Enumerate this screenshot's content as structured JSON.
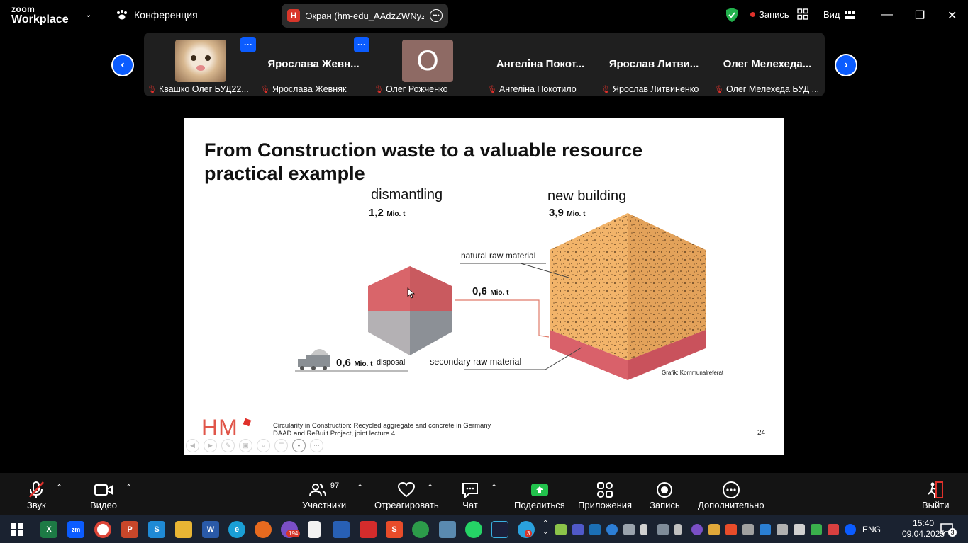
{
  "app": {
    "logo_line1": "zoom",
    "logo_line2": "Workplace",
    "conference_label": "Конференция",
    "screen_badge": "H",
    "screen_title": "Экран (hm-edu_AAdzZWNyZXQ",
    "record_label": "Запись",
    "view_label": "Вид",
    "accent_color": "#0b5cff"
  },
  "participants": [
    {
      "name": "Квашко Олег БУД22...",
      "big_name": "",
      "avatar": "cat-photo",
      "muted": true
    },
    {
      "name": "Ярослава Жевняк",
      "big_name": "Ярослава  Жевн...",
      "avatar": "",
      "muted": true
    },
    {
      "name": "Олег Рожченко",
      "big_name": "",
      "avatar_letter": "О",
      "muted": true
    },
    {
      "name": "Ангеліна Покотило",
      "big_name": "Ангеліна  Покот...",
      "avatar": "",
      "muted": true
    },
    {
      "name": "Ярослав Литвиненко",
      "big_name": "Ярослав  Литви...",
      "avatar": "",
      "muted": true
    },
    {
      "name": "Олег Мелехеда БУД ...",
      "big_name": "Олег  Мелехеда...",
      "avatar": "",
      "muted": true
    }
  ],
  "tile_more": "···",
  "slide": {
    "title_line1": "From Construction waste to a valuable resource",
    "title_line2": "practical example",
    "dismantling": "dismantling",
    "dismantling_amount": "1,2",
    "new_building": "new building",
    "new_building_amount": "3,9",
    "unit": "Mio. t",
    "natural_raw": "natural raw material",
    "flow_amount": "0,6",
    "disposal_amount": "0,6",
    "disposal": "disposal",
    "secondary_raw": "secondary raw material",
    "credit": "Grafik: Kommunalreferat",
    "logo_text": "HM",
    "footer_line1": "Circularity in Construction: Recycled aggregate and concrete in Germany",
    "footer_line2": "DAAD and ReBuilt Project, joint lecture 4",
    "page_number": "24"
  },
  "toolbar": {
    "audio": "Звук",
    "video": "Видео",
    "participants": "Участники",
    "participants_count": "97",
    "react": "Отреагировать",
    "chat": "Чат",
    "share": "Поделиться",
    "apps": "Приложения",
    "record": "Запись",
    "more": "Дополнительно",
    "leave": "Выйти"
  },
  "taskbar": {
    "viber_badge": "194",
    "telegram_badge": "3",
    "language": "ENG",
    "time": "15:40",
    "date": "09.04.2025",
    "notifications": "3"
  }
}
